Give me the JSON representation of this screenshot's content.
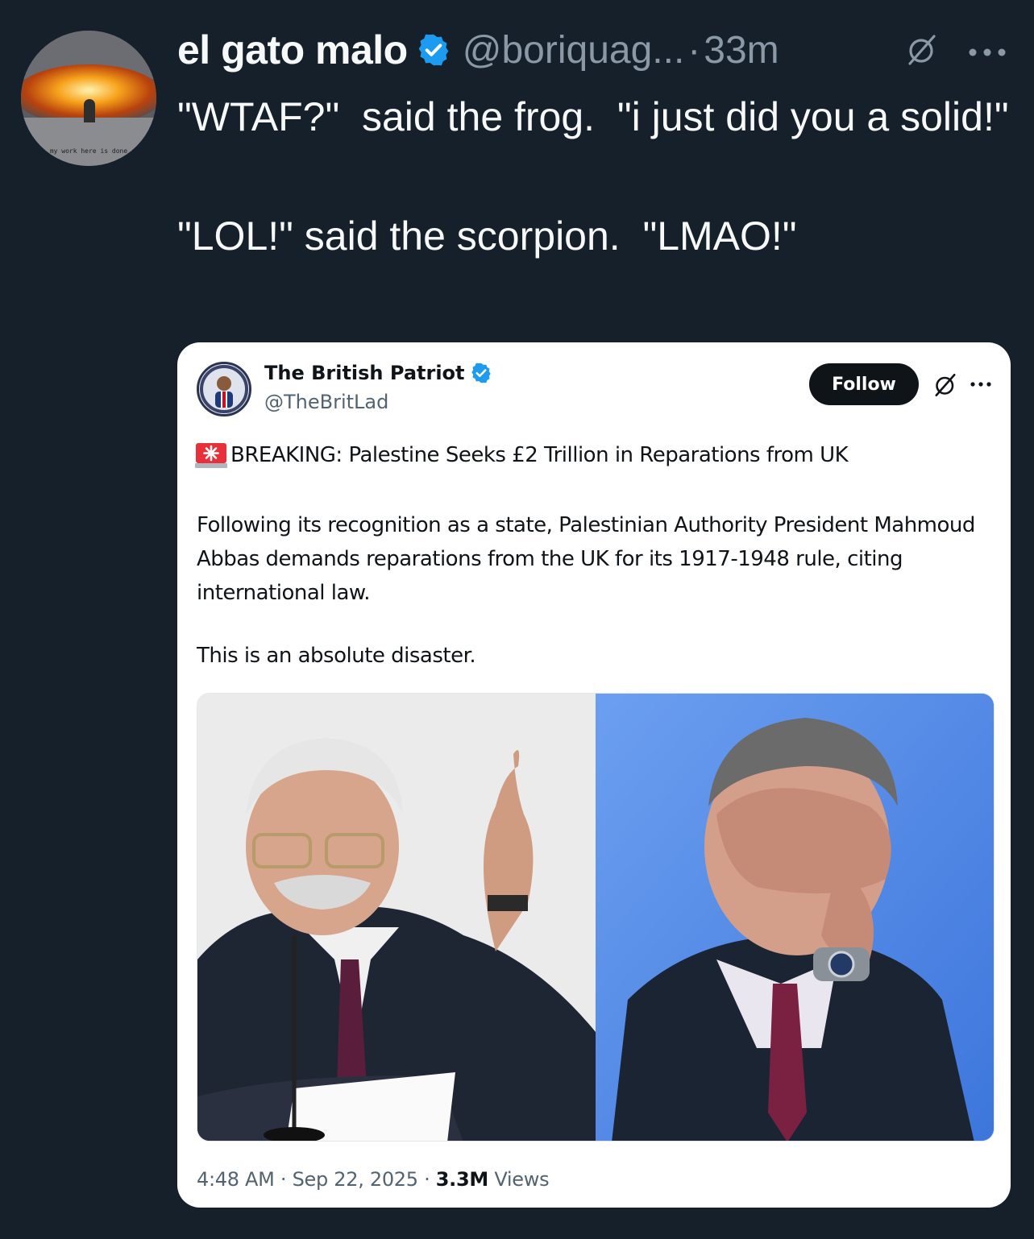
{
  "tweet": {
    "display_name": "el gato malo",
    "handle": "@boriquag...",
    "separator": "·",
    "time": "33m",
    "avatar_text": "my work here is done",
    "body": "\"WTAF?\"  said the frog.  \"i just did you a solid!\"\n\n\"LOL!\" said the scorpion.  \"LMAO!\"",
    "icons": {
      "verified": "verified-badge-icon",
      "grok": "grok-icon",
      "more": "more-options-icon"
    },
    "colors": {
      "background": "#15202b",
      "text": "#f7f9f9",
      "secondary": "#8b98a5",
      "verified": "#1d9bf0"
    }
  },
  "quoted_tweet": {
    "display_name": "The British Patriot",
    "handle": "@TheBritLad",
    "follow_label": "Follow",
    "headline": "BREAKING: Palestine Seeks £2 Trillion in Reparations from UK",
    "paragraph": "Following its recognition as a state, Palestinian Authority President Mahmoud Abbas demands reparations from the UK for its 1917-1948 rule, citing international law.",
    "paragraph2": "This is an absolute disaster.",
    "time": "4:48 AM",
    "date": "Sep 22, 2025",
    "views_count": "3.3M",
    "views_label": "Views",
    "dot": "·",
    "icons": {
      "siren": "siren-icon",
      "verified": "verified-badge-icon",
      "grok": "grok-icon",
      "more": "more-options-icon"
    }
  }
}
